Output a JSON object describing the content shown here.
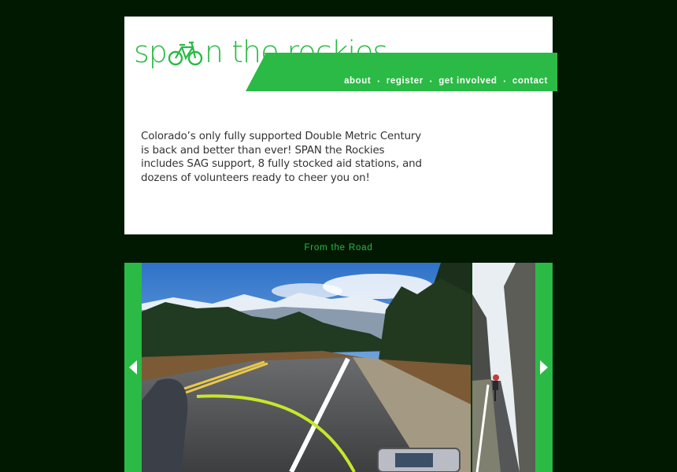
{
  "brand": {
    "logo_text_a": "sp",
    "logo_text_b": "n the ",
    "logo_text_c": "rockies",
    "accent": "#2bba45",
    "background": "#011801"
  },
  "nav": {
    "items": [
      {
        "label": "about"
      },
      {
        "label": "register"
      },
      {
        "label": "get involved"
      },
      {
        "label": "contact"
      }
    ],
    "separator": "•"
  },
  "intro": {
    "text": "Colorado’s only fully supported Double Metric Century is back and better than ever! SPAN the Rockies includes SAG support, 8 fully stocked aid stations, and dozens of volunteers ready to cheer you on!"
  },
  "gallery": {
    "title": "From the Road",
    "prev_icon": "triangle-left-icon",
    "next_icon": "triangle-right-icon"
  }
}
